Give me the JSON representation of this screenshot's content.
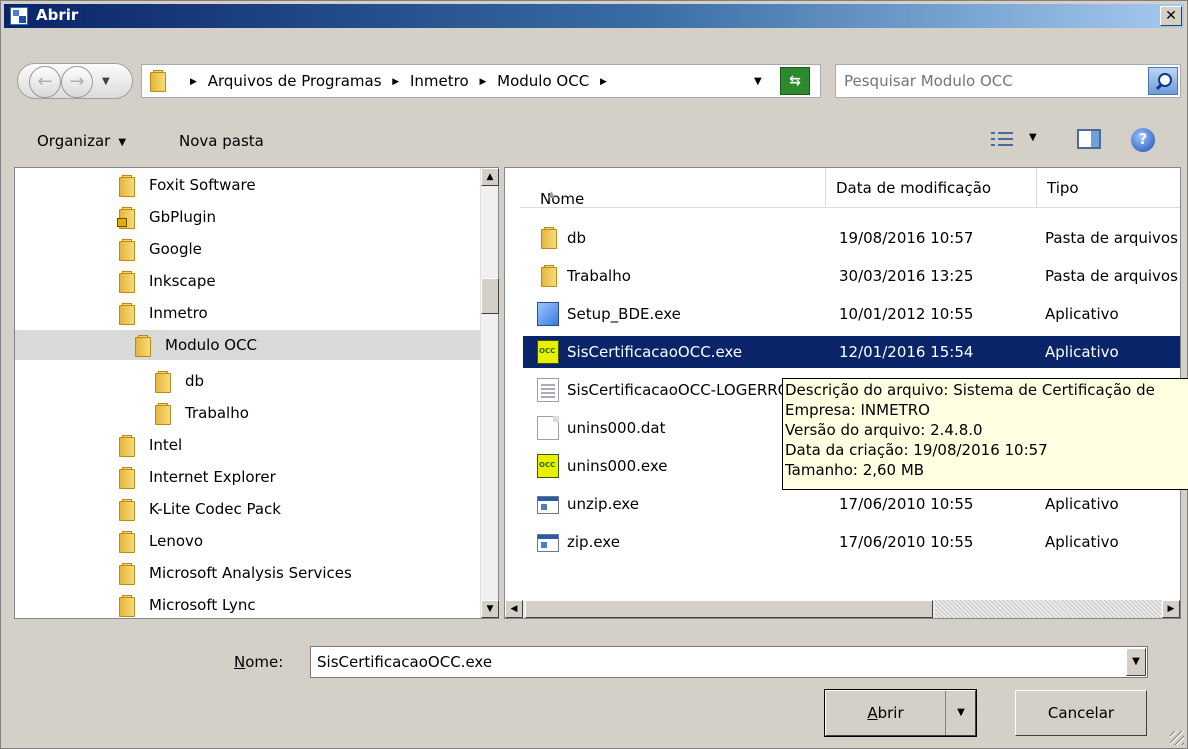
{
  "window": {
    "title": "Abrir",
    "close_glyph": "✕"
  },
  "nav": {
    "breadcrumbs": [
      "Arquivos de Programas",
      "Inmetro",
      "Modulo OCC"
    ],
    "search_placeholder": "Pesquisar Modulo OCC"
  },
  "toolbar": {
    "organize": "Organizar",
    "new_folder": "Nova pasta"
  },
  "tree": {
    "items": [
      {
        "label": "Foxit Software",
        "indent": 1
      },
      {
        "label": "GbPlugin",
        "indent": 1,
        "locked": true
      },
      {
        "label": "Google",
        "indent": 1
      },
      {
        "label": "Inkscape",
        "indent": 1
      },
      {
        "label": "Inmetro",
        "indent": 1
      },
      {
        "label": "Modulo OCC",
        "indent": 2,
        "selected": true
      },
      {
        "label": "db",
        "indent": 3
      },
      {
        "label": "Trabalho",
        "indent": 3
      },
      {
        "label": "Intel",
        "indent": 1
      },
      {
        "label": "Internet Explorer",
        "indent": 1
      },
      {
        "label": "K-Lite Codec Pack",
        "indent": 1
      },
      {
        "label": "Lenovo",
        "indent": 1
      },
      {
        "label": "Microsoft Analysis Services",
        "indent": 1
      },
      {
        "label": "Microsoft Lync",
        "indent": 1
      }
    ]
  },
  "files": {
    "columns": [
      "Nome",
      "Data de modificação",
      "Tipo"
    ],
    "rows": [
      {
        "name": "db",
        "date": "19/08/2016 10:57",
        "type": "Pasta de arquivos",
        "icon": "folder-icon"
      },
      {
        "name": "Trabalho",
        "date": "30/03/2016 13:25",
        "type": "Pasta de arquivos",
        "icon": "folder-icon"
      },
      {
        "name": "Setup_BDE.exe",
        "date": "10/01/2012 10:55",
        "type": "Aplicativo",
        "icon": "setup-icon"
      },
      {
        "name": "SisCertificacaoOCC.exe",
        "date": "12/01/2016 15:54",
        "type": "Aplicativo",
        "icon": "occ-app-icon",
        "selected": true
      },
      {
        "name": "SisCertificacaoOCC-LOGERRO.txt",
        "date": "",
        "type": "",
        "icon": "text-file-icon"
      },
      {
        "name": "unins000.dat",
        "date": "",
        "type": "",
        "icon": "file-icon"
      },
      {
        "name": "unins000.exe",
        "date": "",
        "type": "",
        "icon": "occ-app-icon"
      },
      {
        "name": "unzip.exe",
        "date": "17/06/2010 10:55",
        "type": "Aplicativo",
        "icon": "app-icon"
      },
      {
        "name": "zip.exe",
        "date": "17/06/2010 10:55",
        "type": "Aplicativo",
        "icon": "app-icon"
      }
    ]
  },
  "tooltip": {
    "lines": [
      "Descrição do arquivo: Sistema de Certificação de",
      "Empresa: INMETRO",
      "Versão do arquivo: 2.4.8.0",
      "Data da criação: 19/08/2016 10:57",
      "Tamanho: 2,60 MB"
    ]
  },
  "footer": {
    "name_label_prefix": "N",
    "name_label_rest": "ome:",
    "filename": "SisCertificacaoOCC.exe",
    "open_button_prefix": "A",
    "open_button_rest": "brir",
    "cancel_button": "Cancelar"
  }
}
